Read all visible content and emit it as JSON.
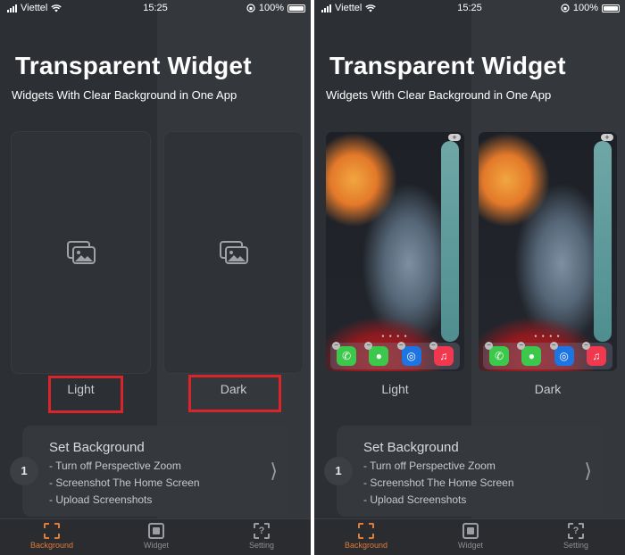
{
  "status": {
    "carrier": "Viettel",
    "time": "15:25",
    "battery": "100%"
  },
  "header": {
    "title": "Transparent Widget",
    "subtitle": "Widgets With Clear Background in One App"
  },
  "options": {
    "light_label": "Light",
    "dark_label": "Dark"
  },
  "set_background": {
    "step": "1",
    "heading": "Set Background",
    "lines": [
      "- Turn off Perspective Zoom",
      "- Screenshot The Home Screen",
      "- Upload Screenshots"
    ],
    "chevron": "⟩"
  },
  "tabs": [
    {
      "label": "Background",
      "icon": "background-icon",
      "active": true
    },
    {
      "label": "Widget",
      "icon": "widget-icon",
      "active": false
    },
    {
      "label": "Setting",
      "icon": "setting-icon",
      "active": false
    }
  ],
  "setting_glyph": "?",
  "highlight_color": "#d9252a",
  "accent_color": "#e07b39",
  "wallpaper": {
    "plus": "+",
    "minus": "−"
  }
}
